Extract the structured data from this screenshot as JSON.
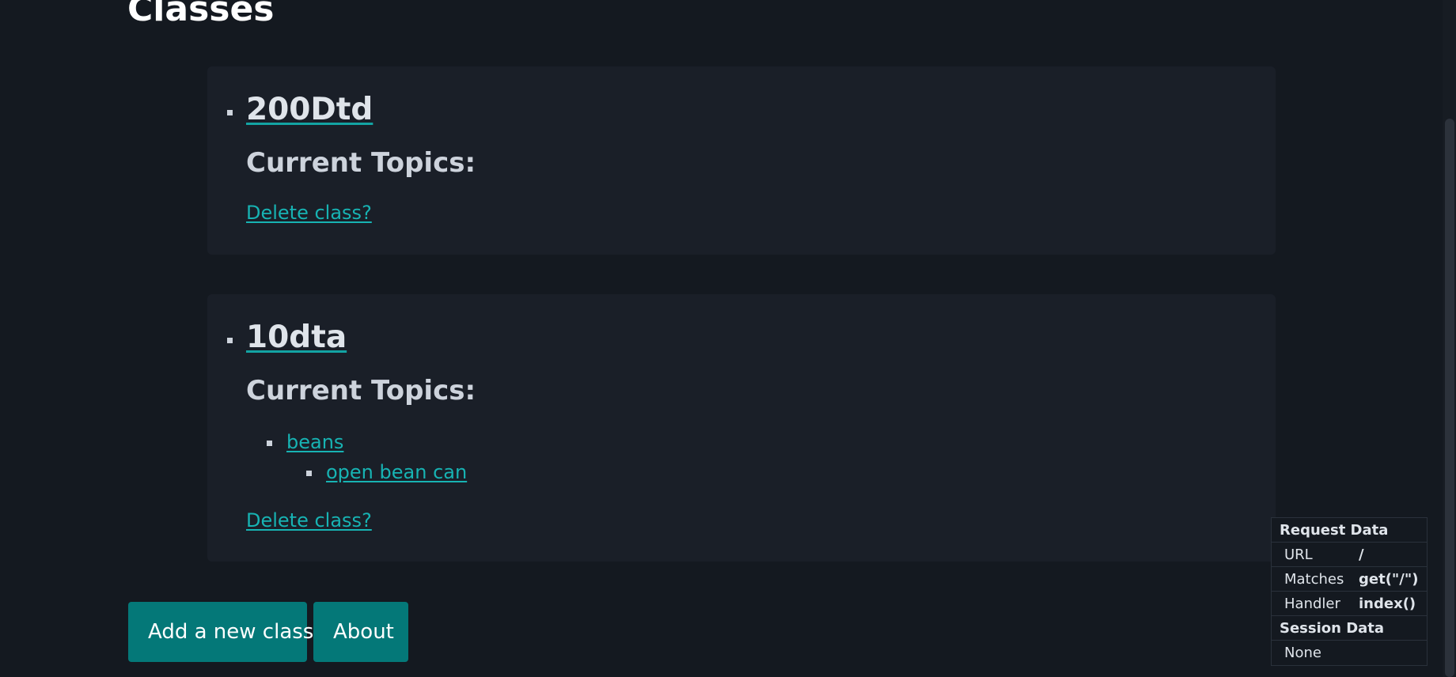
{
  "page": {
    "title": "Classes"
  },
  "classes": [
    {
      "name": "200Dtd",
      "topics_heading": "Current Topics:",
      "topics": [],
      "delete_label": "Delete class?"
    },
    {
      "name": "10dta",
      "topics_heading": "Current Topics:",
      "topics": [
        {
          "label": "beans",
          "subtopics": [
            {
              "label": "open bean can"
            }
          ]
        }
      ],
      "delete_label": "Delete class?"
    }
  ],
  "actions": {
    "add_class_label": "Add a new class",
    "about_label": "About"
  },
  "debug_panel": {
    "request_header": "Request Data",
    "request_rows": [
      {
        "key": "URL",
        "value": "/"
      },
      {
        "key": "Matches",
        "value": "get(\"/\")"
      },
      {
        "key": "Handler",
        "value": "index()"
      }
    ],
    "session_header": "Session Data",
    "session_value": "None"
  },
  "colors": {
    "background": "#141920",
    "card": "#1a1f28",
    "accent": "#047878",
    "link": "#17b3b3",
    "text": "#cdd3dc"
  }
}
